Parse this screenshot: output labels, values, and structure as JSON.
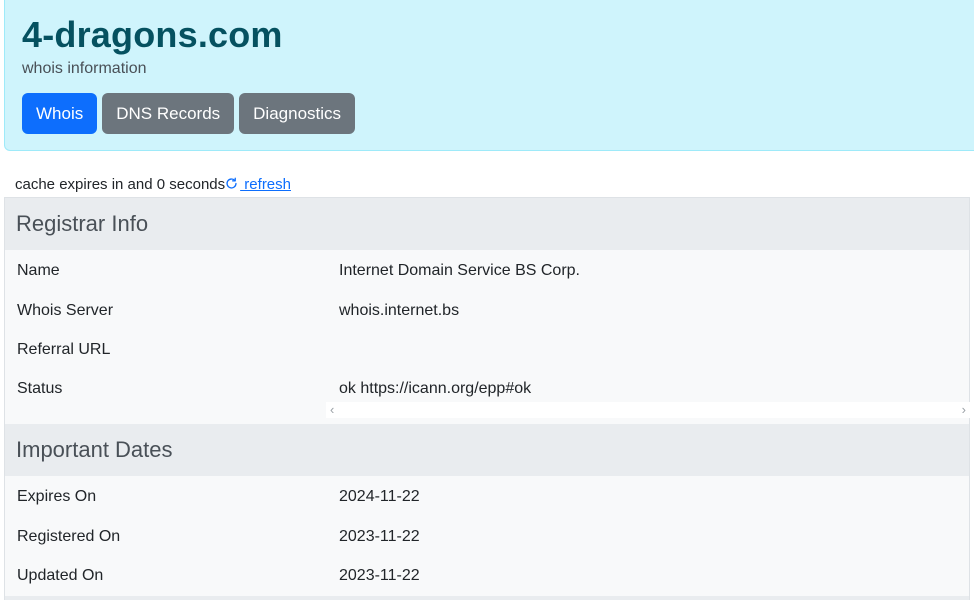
{
  "header": {
    "domain": "4-dragons.com",
    "subtitle": "whois information",
    "tabs": [
      {
        "label": "Whois",
        "active": true
      },
      {
        "label": "DNS Records",
        "active": false
      },
      {
        "label": "Diagnostics",
        "active": false
      }
    ]
  },
  "cache": {
    "text": "cache expires in and 0 seconds",
    "refresh_label": " refresh",
    "icon": "refresh-icon"
  },
  "registrar": {
    "heading": "Registrar Info",
    "rows": [
      {
        "label": "Name",
        "value": "Internet Domain Service BS Corp."
      },
      {
        "label": "Whois Server",
        "value": "whois.internet.bs"
      },
      {
        "label": "Referral URL",
        "value": ""
      },
      {
        "label": "Status",
        "value": "ok https://icann.org/epp#ok"
      }
    ]
  },
  "dates": {
    "heading": "Important Dates",
    "rows": [
      {
        "label": "Expires On",
        "value": "2024-11-22"
      },
      {
        "label": "Registered On",
        "value": "2023-11-22"
      },
      {
        "label": "Updated On",
        "value": "2023-11-22"
      }
    ]
  },
  "colors": {
    "header_bg": "#cff4fc",
    "title": "#055160",
    "active_tab": "#0d6efd",
    "inactive_tab": "#6c757d",
    "link": "#0d6efd"
  }
}
